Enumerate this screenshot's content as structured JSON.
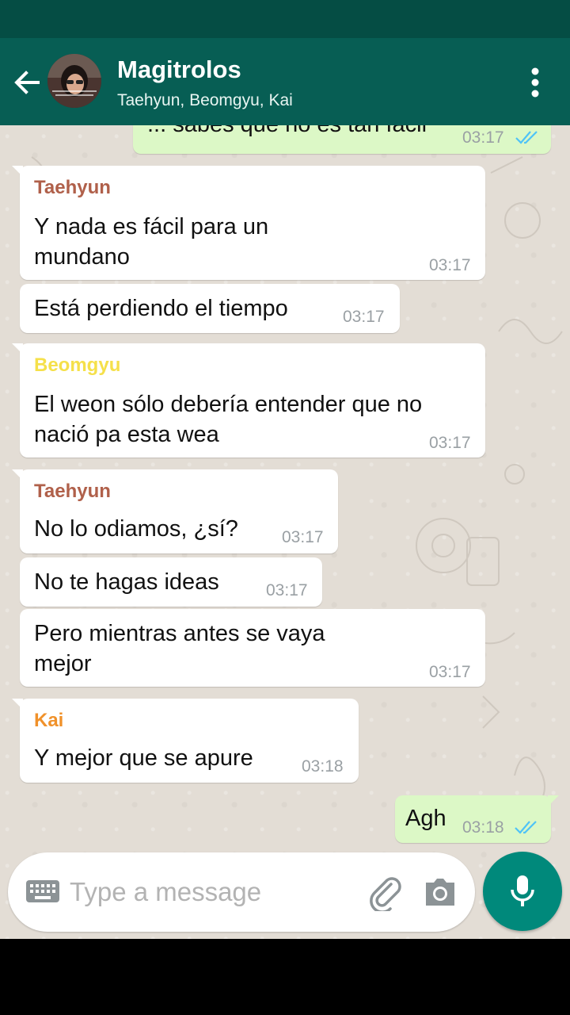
{
  "header": {
    "title": "Magitrolos",
    "members": "Taehyun, Beomgyu, Kai"
  },
  "colors": {
    "header_bg": "#075e54",
    "statusbar_bg": "#054d44",
    "outgoing_bubble": "#dcf8c6",
    "incoming_bubble": "#ffffff",
    "mic_button": "#00897b",
    "read_ticks": "#4fc3f7",
    "sender_taehyun": "#b0604a",
    "sender_beomgyu": "#f5e04a",
    "sender_kai": "#f0912a"
  },
  "messages": [
    {
      "direction": "out",
      "text": "... sabes que no es tan fácil",
      "time": "03:17",
      "status": "read"
    },
    {
      "direction": "in",
      "sender": "Taehyun",
      "lines": [
        "Y nada es fácil para un",
        "mundano"
      ],
      "time": "03:17"
    },
    {
      "direction": "in",
      "text": "Está perdiendo el tiempo",
      "time": "03:17"
    },
    {
      "direction": "in",
      "sender": "Beomgyu",
      "lines": [
        "El weon sólo debería entender que no",
        "nació pa esta wea"
      ],
      "time": "03:17"
    },
    {
      "direction": "in",
      "sender": "Taehyun",
      "text": "No lo odiamos, ¿sí?",
      "time": "03:17"
    },
    {
      "direction": "in",
      "text": "No te hagas ideas",
      "time": "03:17"
    },
    {
      "direction": "in",
      "lines": [
        "Pero mientras antes se vaya",
        "mejor"
      ],
      "time": "03:17"
    },
    {
      "direction": "in",
      "sender": "Kai",
      "text": "Y mejor que se apure",
      "time": "03:18"
    },
    {
      "direction": "out",
      "text": "Agh",
      "time": "03:18",
      "status": "read"
    }
  ],
  "input": {
    "placeholder": "Type a message"
  },
  "icons": {
    "back": "arrow-left-icon",
    "menu": "more-vert-icon",
    "keyboard": "keyboard-icon",
    "attach": "paperclip-icon",
    "camera": "camera-icon",
    "mic": "microphone-icon"
  }
}
